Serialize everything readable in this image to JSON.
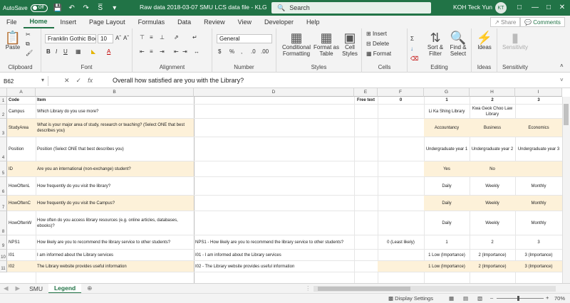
{
  "titlebar": {
    "autosave_label": "AutoSave",
    "autosave_state": "Off",
    "doc_title": "Raw data 2018-03-07 SMU LCS data file  -  KLG",
    "search_placeholder": "Search",
    "user_name": "KOH Teck Yun",
    "user_initials": "KT"
  },
  "menu": {
    "items": [
      "File",
      "Home",
      "Insert",
      "Page Layout",
      "Formulas",
      "Data",
      "Review",
      "View",
      "Developer",
      "Help"
    ],
    "active": "Home",
    "share": "Share",
    "comments": "Comments"
  },
  "ribbon": {
    "clipboard": {
      "paste": "Paste",
      "label": "Clipboard"
    },
    "font": {
      "family": "Franklin Gothic Boo",
      "size": "10",
      "label": "Font"
    },
    "alignment": {
      "label": "Alignment"
    },
    "number": {
      "format": "General",
      "label": "Number"
    },
    "styles": {
      "conditional": "Conditional",
      "conditional2": "Formatting",
      "format_as": "Format as",
      "format_as2": "Table",
      "cell": "Cell",
      "cell2": "Styles",
      "label": "Styles"
    },
    "cells": {
      "insert": "Insert",
      "delete": "Delete",
      "format": "Format",
      "label": "Cells"
    },
    "editing": {
      "sort": "Sort &",
      "sort2": "Filter",
      "find": "Find &",
      "find2": "Select",
      "label": "Editing"
    },
    "ideas": {
      "btn": "Ideas",
      "label": "Ideas"
    },
    "sensitivity": {
      "btn": "Sensitivity",
      "label": "Sensitivity"
    }
  },
  "formula_bar": {
    "name_box": "B62",
    "formula": "Overall how satisfied are you with the Library?"
  },
  "grid": {
    "columns": [
      "A",
      "B",
      "D",
      "E",
      "F",
      "G",
      "H",
      "I"
    ],
    "header_row": {
      "a": "Code",
      "b": "Item",
      "e": "Free text",
      "f": "0",
      "g": "1",
      "h": "2",
      "i": "3"
    },
    "rows": [
      {
        "num": "2",
        "a": "Campus",
        "b": "Which Library do you use more?",
        "d": "",
        "f": "",
        "g": "Li Ka Shing Library",
        "h": "Kwa Geok Choo Law Library",
        "i": ""
      },
      {
        "num": "3",
        "a": "StudyArea",
        "b": "What is your major area of study, research or teaching? (Select ONE that best describes you)",
        "d": "",
        "f": "",
        "g": "Accountancy",
        "h": "Business",
        "i": "Economics"
      },
      {
        "num": "4",
        "a": "Position",
        "b": "Position (Select ONE that best describes you)",
        "d": "",
        "f": "",
        "g": "Undergraduate year 1",
        "h": "Undergraduate year 2",
        "i": "Undergraduate year 3"
      },
      {
        "num": "5",
        "a": "ID",
        "b": "Are you an international (non-exchange) student?",
        "d": "",
        "f": "",
        "g": "Yes",
        "h": "No",
        "i": ""
      },
      {
        "num": "6",
        "a": "HowOftenL",
        "b": "How frequently do you visit the library?",
        "d": "",
        "f": "",
        "g": "Daily",
        "h": "Weekly",
        "i": "Monthly"
      },
      {
        "num": "7",
        "a": "HowOftenC",
        "b": "How frequently do you visit the Campus?",
        "d": "",
        "f": "",
        "g": "Daily",
        "h": "Weekly",
        "i": "Monthly"
      },
      {
        "num": "8",
        "a": "HowOftenW",
        "b": "How often do you access library resources (e.g. online articles, databases, ebooks)?",
        "d": "",
        "f": "",
        "g": "Daily",
        "h": "Weekly",
        "i": "Monthly"
      },
      {
        "num": "9",
        "a": "NPS1",
        "b": "How likely are you to recommend the library service to other students?",
        "d": "NPS1 - How likely are you to recommend the library service to other students?",
        "f": "0 (Least likely)",
        "g": "1",
        "h": "2",
        "i": "3"
      },
      {
        "num": "10",
        "a": "I01",
        "b": "I am informed about the Library services",
        "d": "I01 - I am informed about the Library services",
        "f": "",
        "g": "1 Low (Importance)",
        "h": "2 (Importance)",
        "i": "3 (Importance)"
      },
      {
        "num": "11",
        "a": "I02",
        "b": "The Library website provides useful information",
        "d": "I02 - The Library website provides useful information",
        "f": "",
        "g": "1 Low (Importance)",
        "h": "2 (Importance)",
        "i": "3 (Importance)"
      }
    ]
  },
  "sheet_tabs": {
    "tabs": [
      "SMU",
      "Legend"
    ],
    "active": "Legend"
  },
  "status": {
    "display_settings": "Display Settings",
    "zoom": "70%"
  }
}
